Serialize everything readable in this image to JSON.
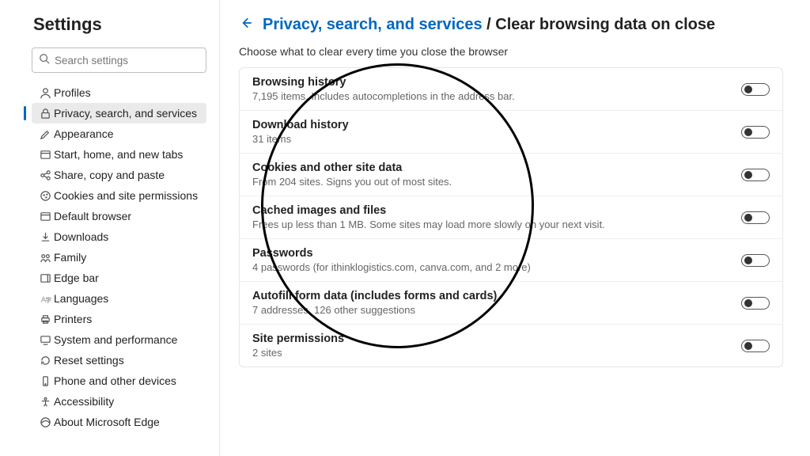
{
  "sidebar": {
    "title": "Settings",
    "search_placeholder": "Search settings",
    "items": [
      {
        "label": "Profiles"
      },
      {
        "label": "Privacy, search, and services"
      },
      {
        "label": "Appearance"
      },
      {
        "label": "Start, home, and new tabs"
      },
      {
        "label": "Share, copy and paste"
      },
      {
        "label": "Cookies and site permissions"
      },
      {
        "label": "Default browser"
      },
      {
        "label": "Downloads"
      },
      {
        "label": "Family"
      },
      {
        "label": "Edge bar"
      },
      {
        "label": "Languages"
      },
      {
        "label": "Printers"
      },
      {
        "label": "System and performance"
      },
      {
        "label": "Reset settings"
      },
      {
        "label": "Phone and other devices"
      },
      {
        "label": "Accessibility"
      },
      {
        "label": "About Microsoft Edge"
      }
    ]
  },
  "main": {
    "breadcrumb_parent": "Privacy, search, and services",
    "breadcrumb_sep": " / ",
    "breadcrumb_current": "Clear browsing data on close",
    "subtitle": "Choose what to clear every time you close the browser",
    "rows": [
      {
        "title": "Browsing history",
        "sub": "7,195 items. Includes autocompletions in the address bar."
      },
      {
        "title": "Download history",
        "sub": "31 items"
      },
      {
        "title": "Cookies and other site data",
        "sub": "From 204 sites. Signs you out of most sites."
      },
      {
        "title": "Cached images and files",
        "sub": "Frees up less than 1 MB. Some sites may load more slowly on your next visit."
      },
      {
        "title": "Passwords",
        "sub": "4 passwords (for ithinklogistics.com, canva.com, and 2 more)"
      },
      {
        "title": "Autofill form data (includes forms and cards)",
        "sub": "7 addresses, 126 other suggestions"
      },
      {
        "title": "Site permissions",
        "sub": "2 sites"
      }
    ]
  }
}
